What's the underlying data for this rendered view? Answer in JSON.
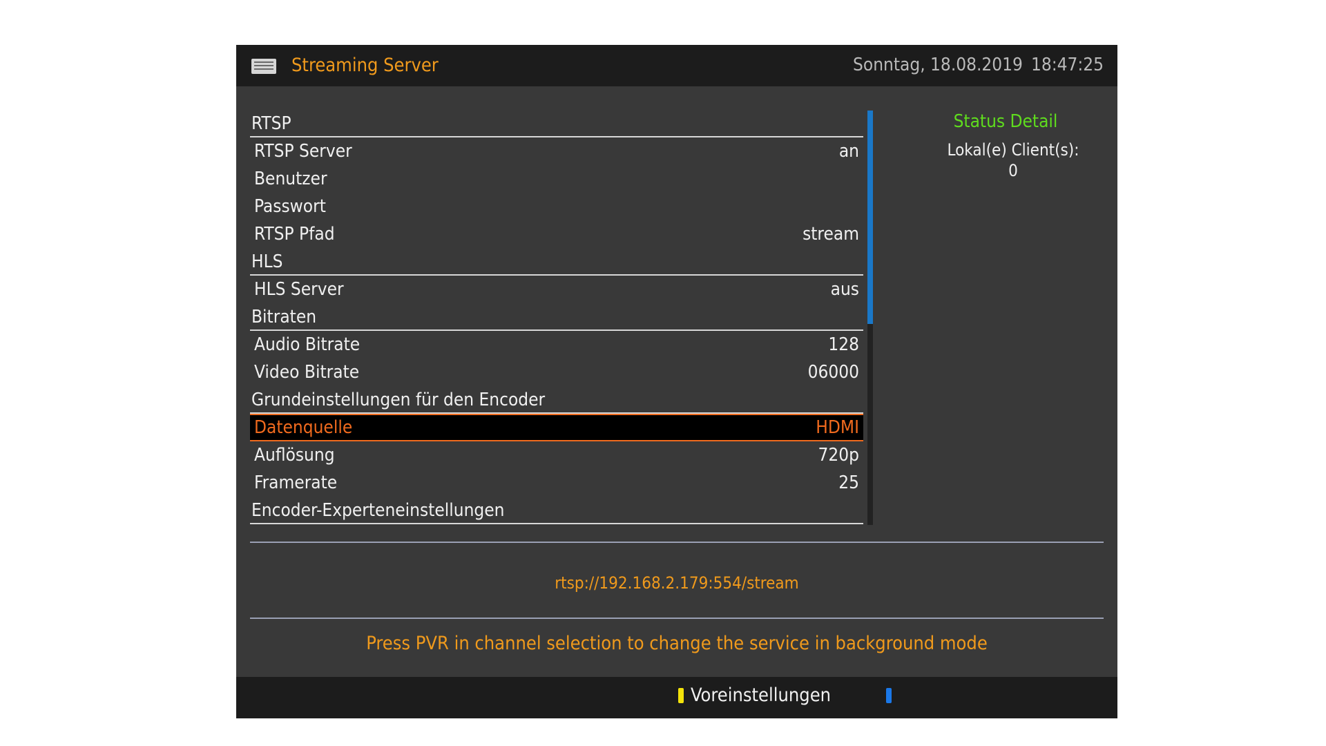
{
  "header": {
    "title": "Streaming Server",
    "date": "Sonntag, 18.08.2019",
    "time": "18:47:25",
    "icon": "streaming-server-icon"
  },
  "menu": [
    {
      "type": "section",
      "label": "RTSP",
      "value": ""
    },
    {
      "type": "item",
      "label": "RTSP Server",
      "value": "an"
    },
    {
      "type": "item",
      "label": "Benutzer",
      "value": ""
    },
    {
      "type": "item",
      "label": "Passwort",
      "value": ""
    },
    {
      "type": "item",
      "label": "RTSP Pfad",
      "value": "stream"
    },
    {
      "type": "section",
      "label": "HLS",
      "value": ""
    },
    {
      "type": "item",
      "label": "HLS Server",
      "value": "aus"
    },
    {
      "type": "section",
      "label": "Bitraten",
      "value": ""
    },
    {
      "type": "item",
      "label": "Audio Bitrate",
      "value": "128"
    },
    {
      "type": "item",
      "label": "Video Bitrate",
      "value": "06000"
    },
    {
      "type": "section",
      "label": "Grundeinstellungen für den Encoder",
      "value": ""
    },
    {
      "type": "item",
      "label": "Datenquelle",
      "value": "HDMI",
      "selected": true
    },
    {
      "type": "item",
      "label": "Auflösung",
      "value": "720p"
    },
    {
      "type": "item",
      "label": "Framerate",
      "value": "25"
    },
    {
      "type": "section",
      "label": "Encoder-Experteneinstellungen",
      "value": ""
    }
  ],
  "status": {
    "title": "Status Detail",
    "clients_label": "Lokal(e) Client(s):",
    "clients_value": "0"
  },
  "url": "rtsp://192.168.2.179:554/stream",
  "hint": "Press PVR in channel selection to change the service in background mode",
  "footer": {
    "yellow_label": "Voreinstellungen",
    "blue_label": ""
  },
  "colors": {
    "accent_orange": "#f09a1c",
    "selected": "#f06a1e",
    "status_green": "#5fdc1e",
    "scrollbar_blue": "#1a78c8",
    "key_yellow": "#f2e20a",
    "key_blue": "#1a78e8"
  }
}
